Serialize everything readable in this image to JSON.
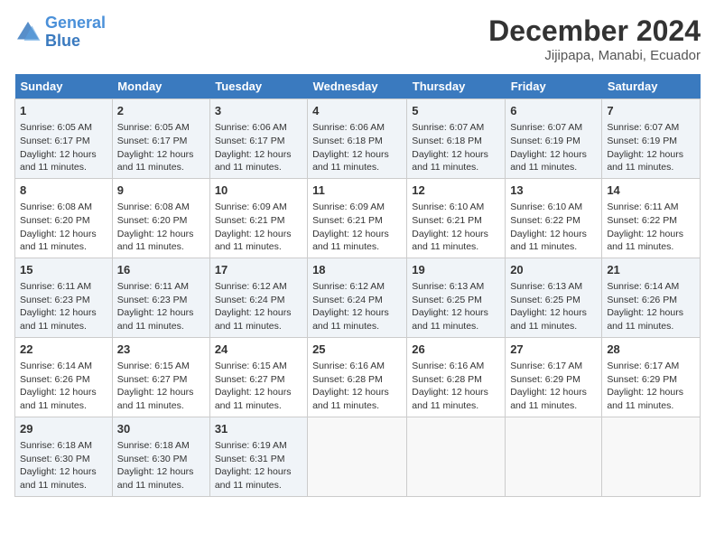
{
  "header": {
    "logo_line1": "General",
    "logo_line2": "Blue",
    "title": "December 2024",
    "subtitle": "Jijipapa, Manabi, Ecuador"
  },
  "weekdays": [
    "Sunday",
    "Monday",
    "Tuesday",
    "Wednesday",
    "Thursday",
    "Friday",
    "Saturday"
  ],
  "weeks": [
    [
      {
        "day": "1",
        "info": "Sunrise: 6:05 AM\nSunset: 6:17 PM\nDaylight: 12 hours and 11 minutes."
      },
      {
        "day": "2",
        "info": "Sunrise: 6:05 AM\nSunset: 6:17 PM\nDaylight: 12 hours and 11 minutes."
      },
      {
        "day": "3",
        "info": "Sunrise: 6:06 AM\nSunset: 6:17 PM\nDaylight: 12 hours and 11 minutes."
      },
      {
        "day": "4",
        "info": "Sunrise: 6:06 AM\nSunset: 6:18 PM\nDaylight: 12 hours and 11 minutes."
      },
      {
        "day": "5",
        "info": "Sunrise: 6:07 AM\nSunset: 6:18 PM\nDaylight: 12 hours and 11 minutes."
      },
      {
        "day": "6",
        "info": "Sunrise: 6:07 AM\nSunset: 6:19 PM\nDaylight: 12 hours and 11 minutes."
      },
      {
        "day": "7",
        "info": "Sunrise: 6:07 AM\nSunset: 6:19 PM\nDaylight: 12 hours and 11 minutes."
      }
    ],
    [
      {
        "day": "8",
        "info": "Sunrise: 6:08 AM\nSunset: 6:20 PM\nDaylight: 12 hours and 11 minutes."
      },
      {
        "day": "9",
        "info": "Sunrise: 6:08 AM\nSunset: 6:20 PM\nDaylight: 12 hours and 11 minutes."
      },
      {
        "day": "10",
        "info": "Sunrise: 6:09 AM\nSunset: 6:21 PM\nDaylight: 12 hours and 11 minutes."
      },
      {
        "day": "11",
        "info": "Sunrise: 6:09 AM\nSunset: 6:21 PM\nDaylight: 12 hours and 11 minutes."
      },
      {
        "day": "12",
        "info": "Sunrise: 6:10 AM\nSunset: 6:21 PM\nDaylight: 12 hours and 11 minutes."
      },
      {
        "day": "13",
        "info": "Sunrise: 6:10 AM\nSunset: 6:22 PM\nDaylight: 12 hours and 11 minutes."
      },
      {
        "day": "14",
        "info": "Sunrise: 6:11 AM\nSunset: 6:22 PM\nDaylight: 12 hours and 11 minutes."
      }
    ],
    [
      {
        "day": "15",
        "info": "Sunrise: 6:11 AM\nSunset: 6:23 PM\nDaylight: 12 hours and 11 minutes."
      },
      {
        "day": "16",
        "info": "Sunrise: 6:11 AM\nSunset: 6:23 PM\nDaylight: 12 hours and 11 minutes."
      },
      {
        "day": "17",
        "info": "Sunrise: 6:12 AM\nSunset: 6:24 PM\nDaylight: 12 hours and 11 minutes."
      },
      {
        "day": "18",
        "info": "Sunrise: 6:12 AM\nSunset: 6:24 PM\nDaylight: 12 hours and 11 minutes."
      },
      {
        "day": "19",
        "info": "Sunrise: 6:13 AM\nSunset: 6:25 PM\nDaylight: 12 hours and 11 minutes."
      },
      {
        "day": "20",
        "info": "Sunrise: 6:13 AM\nSunset: 6:25 PM\nDaylight: 12 hours and 11 minutes."
      },
      {
        "day": "21",
        "info": "Sunrise: 6:14 AM\nSunset: 6:26 PM\nDaylight: 12 hours and 11 minutes."
      }
    ],
    [
      {
        "day": "22",
        "info": "Sunrise: 6:14 AM\nSunset: 6:26 PM\nDaylight: 12 hours and 11 minutes."
      },
      {
        "day": "23",
        "info": "Sunrise: 6:15 AM\nSunset: 6:27 PM\nDaylight: 12 hours and 11 minutes."
      },
      {
        "day": "24",
        "info": "Sunrise: 6:15 AM\nSunset: 6:27 PM\nDaylight: 12 hours and 11 minutes."
      },
      {
        "day": "25",
        "info": "Sunrise: 6:16 AM\nSunset: 6:28 PM\nDaylight: 12 hours and 11 minutes."
      },
      {
        "day": "26",
        "info": "Sunrise: 6:16 AM\nSunset: 6:28 PM\nDaylight: 12 hours and 11 minutes."
      },
      {
        "day": "27",
        "info": "Sunrise: 6:17 AM\nSunset: 6:29 PM\nDaylight: 12 hours and 11 minutes."
      },
      {
        "day": "28",
        "info": "Sunrise: 6:17 AM\nSunset: 6:29 PM\nDaylight: 12 hours and 11 minutes."
      }
    ],
    [
      {
        "day": "29",
        "info": "Sunrise: 6:18 AM\nSunset: 6:30 PM\nDaylight: 12 hours and 11 minutes."
      },
      {
        "day": "30",
        "info": "Sunrise: 6:18 AM\nSunset: 6:30 PM\nDaylight: 12 hours and 11 minutes."
      },
      {
        "day": "31",
        "info": "Sunrise: 6:19 AM\nSunset: 6:31 PM\nDaylight: 12 hours and 11 minutes."
      },
      null,
      null,
      null,
      null
    ]
  ]
}
